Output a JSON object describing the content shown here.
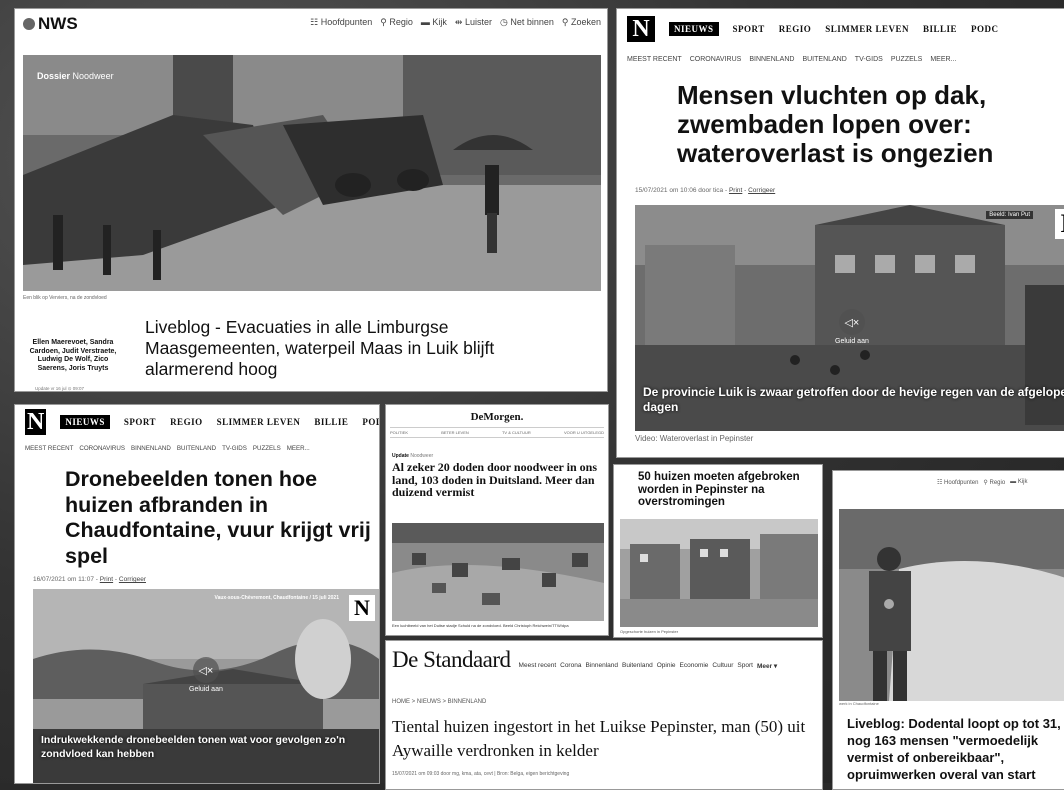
{
  "panel1": {
    "logo": "NWS",
    "nav": [
      "Hoofdpunten",
      "Regio",
      "Kijk",
      "Luister",
      "Net binnen",
      "Zoeken"
    ],
    "nav_icons": [
      "grid-icon",
      "pin-icon",
      "tv-icon",
      "headphone-icon",
      "clock-icon",
      "search-icon"
    ],
    "dossier_label": "Dossier",
    "dossier_value": "Noodweer",
    "photo_caption": "Een blik op Verviers, na de zondvloed",
    "authors": "Ellen Maerevoet, Sandra Cardoen, Judit Verstraete, Ludwig De Wolf, Zico Saerens, Joris Truyts",
    "update": "Update vr 16 jul ⊙ 09:07",
    "title": "Liveblog - Evacuaties in alle Limburgse Maasgemeenten, waterpeil Maas in Luik blijft alarmerend hoog"
  },
  "nieuwsblad_nav": {
    "logo": "N",
    "tabs": [
      "NIEUWS",
      "SPORT",
      "REGIO",
      "SLIMMER LEVEN",
      "BILLIE",
      "PODCA"
    ],
    "sub": [
      "MEEST RECENT",
      "CORONAVIRUS",
      "BINNENLAND",
      "BUITENLAND",
      "TV-GIDS",
      "PUZZELS",
      "MEER..."
    ]
  },
  "panel2": {
    "tabs_tail": "PODC",
    "title": "Mensen vluchten op dak, zwembaden lopen over: wateroverlast is ongezien",
    "meta_prefix": "15/07/2021 om 10:06 door tica - ",
    "print": "Print",
    "correction": "Corrigeer",
    "beeld": "Beeld: Ivan Put",
    "sound": "Geluid aan",
    "video_caption": "De provincie Luik is zwaar getroffen door de hevige regen van de afgelopen dagen",
    "video_label": "Video: Wateroverlast in Pepinster"
  },
  "panel3": {
    "title": "Dronebeelden tonen hoe huizen afbranden in Chaudfontaine, vuur krijgt vrij spel",
    "meta_prefix": "16/07/2021 om 11:07 - ",
    "print": "Print",
    "correction": "Corrigeer",
    "location": "Vaux-sous-Chèvremont, Chaudfontaine / 15 juli 2021",
    "sound": "Geluid aan",
    "video_caption": "Indrukwekkende dronebeelden tonen wat voor gevolgen zo'n zondvloed kan hebben"
  },
  "panel4": {
    "logo": "DeMorgen.",
    "nav": [
      "POLITIEK",
      "BETER LEVEN",
      "TV & CULTUUR",
      "VOOR U UITGELEGD"
    ],
    "update_label": "Update",
    "update_value": "Noodweer",
    "title": "Al zeker 20 doden door noodweer in ons land, 103 doden in Duitsland. Meer dan duizend vermist",
    "caption": "Een luchtbeeld van het Duitse stadje Schuld na de zondvloed.  Beeld Christoph Reichwein/TTW/dpa"
  },
  "panel5": {
    "title": "50 huizen moeten afgebroken worden in Pepinster na overstromingen",
    "caption": "Opgeschorte huizen in Pepinster"
  },
  "panel6": {
    "logo": "De Standaard",
    "nav": [
      "Meest recent",
      "Corona",
      "Binnenland",
      "Buitenland",
      "Opinie",
      "Economie",
      "Cultuur",
      "Sport",
      "Meer ▾"
    ],
    "crumb": "HOME > NIEUWS > BINNENLAND",
    "title": "Tiental huizen ingestort in het Luikse Pepinster, man (50) uit Aywaille verdronken in kelder",
    "meta": "15/07/2021 om 09:03 door mg, kma, ata, cevt | Bron: Belga, eigen berichtgeving"
  },
  "panel7": {
    "nav": [
      "Hoofdpunten",
      "Regio",
      "Kijk"
    ],
    "caption": "werk in Chaudfontaine",
    "title": "Liveblog: Dodental loopt op tot 31, nog 163 mensen \"vermoedelijk vermist of onbereikbaar\", opruimwerken overal van start"
  }
}
